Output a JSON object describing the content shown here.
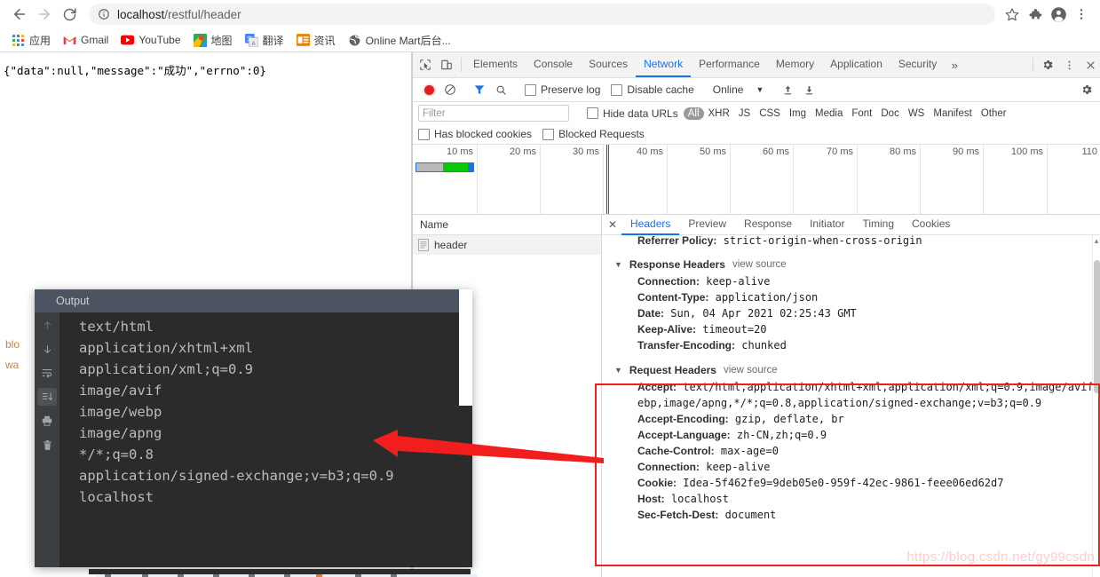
{
  "browser": {
    "nav": {
      "back": "back-arrow",
      "forward": "forward-arrow",
      "reload": "reload"
    },
    "omnibox": {
      "info_icon": "site-info-icon",
      "host": "localhost",
      "path": "/restful/header",
      "full": "localhost/restful/header"
    },
    "right_icons": [
      "bookmark-star",
      "extensions-puzzle",
      "profile-avatar",
      "overflow-menu"
    ],
    "bookmarks": [
      {
        "label": "应用",
        "icon": "apps-grid-icon"
      },
      {
        "label": "Gmail",
        "icon": "gmail-icon"
      },
      {
        "label": "YouTube",
        "icon": "youtube-icon"
      },
      {
        "label": "地图",
        "icon": "google-maps-icon"
      },
      {
        "label": "翻译",
        "icon": "google-translate-icon"
      },
      {
        "label": "资讯",
        "icon": "google-news-icon"
      },
      {
        "label": "Online Mart后台...",
        "icon": "globe-icon"
      }
    ]
  },
  "page": {
    "response_json": "{\"data\":null,\"message\":\"成功\",\"errno\":0}",
    "ghost_left": [
      "blo",
      "wa"
    ]
  },
  "devtools": {
    "panel_tabs": [
      "Elements",
      "Console",
      "Sources",
      "Network",
      "Performance",
      "Memory",
      "Application",
      "Security"
    ],
    "active_panel_tab": "Network",
    "more_tabs_icon": "chevron-double-right-icon",
    "settings_icon": "gear-icon",
    "kebab_icon": "more-vertical-icon",
    "close_icon": "close-icon",
    "inspect_icon": "inspect-element-icon",
    "device_icon": "device-toolbar-icon",
    "toolbar": {
      "record_icon": "record-button",
      "clear_icon": "clear-button",
      "filter_icon": "filter-funnel-icon",
      "search_icon": "search-icon",
      "preserve_log": "Preserve log",
      "disable_cache": "Disable cache",
      "throttle": "Online",
      "import_icon": "import-har-icon",
      "export_icon": "export-har-icon",
      "network_settings_icon": "network-settings-gear-icon"
    },
    "filterbar": {
      "filter_placeholder": "Filter",
      "hide_data_urls": "Hide data URLs",
      "types": [
        "All",
        "XHR",
        "JS",
        "CSS",
        "Img",
        "Media",
        "Font",
        "Doc",
        "WS",
        "Manifest",
        "Other"
      ],
      "active_type": "All",
      "has_blocked_cookies": "Has blocked cookies",
      "blocked_requests": "Blocked Requests"
    },
    "timeline": {
      "ticks": [
        "10 ms",
        "20 ms",
        "30 ms",
        "40 ms",
        "50 ms",
        "60 ms",
        "70 ms",
        "80 ms",
        "90 ms",
        "100 ms",
        "110"
      ]
    },
    "requests": {
      "column_header": "Name",
      "rows": [
        {
          "name": "header",
          "icon": "document-icon"
        }
      ]
    },
    "detail_tabs": [
      "Headers",
      "Preview",
      "Response",
      "Initiator",
      "Timing",
      "Cookies"
    ],
    "active_detail_tab": "Headers",
    "headers": {
      "top_partial": {
        "key": "Referrer Policy:",
        "value": "strict-origin-when-cross-origin"
      },
      "response": {
        "title": "Response Headers",
        "view_source": "view source",
        "rows": [
          {
            "key": "Connection:",
            "value": "keep-alive"
          },
          {
            "key": "Content-Type:",
            "value": "application/json"
          },
          {
            "key": "Date:",
            "value": "Sun, 04 Apr 2021 02:25:43 GMT"
          },
          {
            "key": "Keep-Alive:",
            "value": "timeout=20"
          },
          {
            "key": "Transfer-Encoding:",
            "value": "chunked"
          }
        ]
      },
      "request": {
        "title": "Request Headers",
        "view_source": "view source",
        "rows": [
          {
            "key": "Accept:",
            "value": "text/html,application/xhtml+xml,application/xml;q=0.9,image/avif,image/w"
          },
          {
            "key": "",
            "value": "ebp,image/apng,*/*;q=0.8,application/signed-exchange;v=b3;q=0.9"
          },
          {
            "key": "Accept-Encoding:",
            "value": "gzip, deflate, br"
          },
          {
            "key": "Accept-Language:",
            "value": "zh-CN,zh;q=0.9"
          },
          {
            "key": "Cache-Control:",
            "value": "max-age=0"
          },
          {
            "key": "Connection:",
            "value": "keep-alive"
          },
          {
            "key": "Cookie:",
            "value": "Idea-5f462fe9=9deb05e0-959f-42ec-9861-feee06ed62d7"
          },
          {
            "key": "Host:",
            "value": "localhost"
          },
          {
            "key": "Sec-Fetch-Dest:",
            "value": "document"
          }
        ]
      }
    }
  },
  "output_panel": {
    "title": "Output",
    "gutter_icons": [
      "scroll-up-icon",
      "scroll-down-icon",
      "soft-wrap-icon",
      "scroll-to-end-icon",
      "print-icon",
      "trash-icon"
    ],
    "lines": [
      "text/html",
      "application/xhtml+xml",
      "application/xml;q=0.9",
      "image/avif",
      "image/webp",
      "image/apng",
      "*/*;q=0.8",
      "application/signed-exchange;v=b3;q=0.9",
      "localhost"
    ]
  },
  "annotations": {
    "red_box_label": "request-headers-highlight",
    "arrow_label": "red-pointer-arrow",
    "watermark": "https://blog.csdn.net/gy99csdn"
  },
  "colors": {
    "accent_blue": "#1a73e8",
    "record_red": "#e02020",
    "annotation_red": "#f21e1e",
    "waterfall_green": "#0bc80b",
    "output_bg": "#2b2b2b",
    "output_title_bg": "#4c5361"
  }
}
